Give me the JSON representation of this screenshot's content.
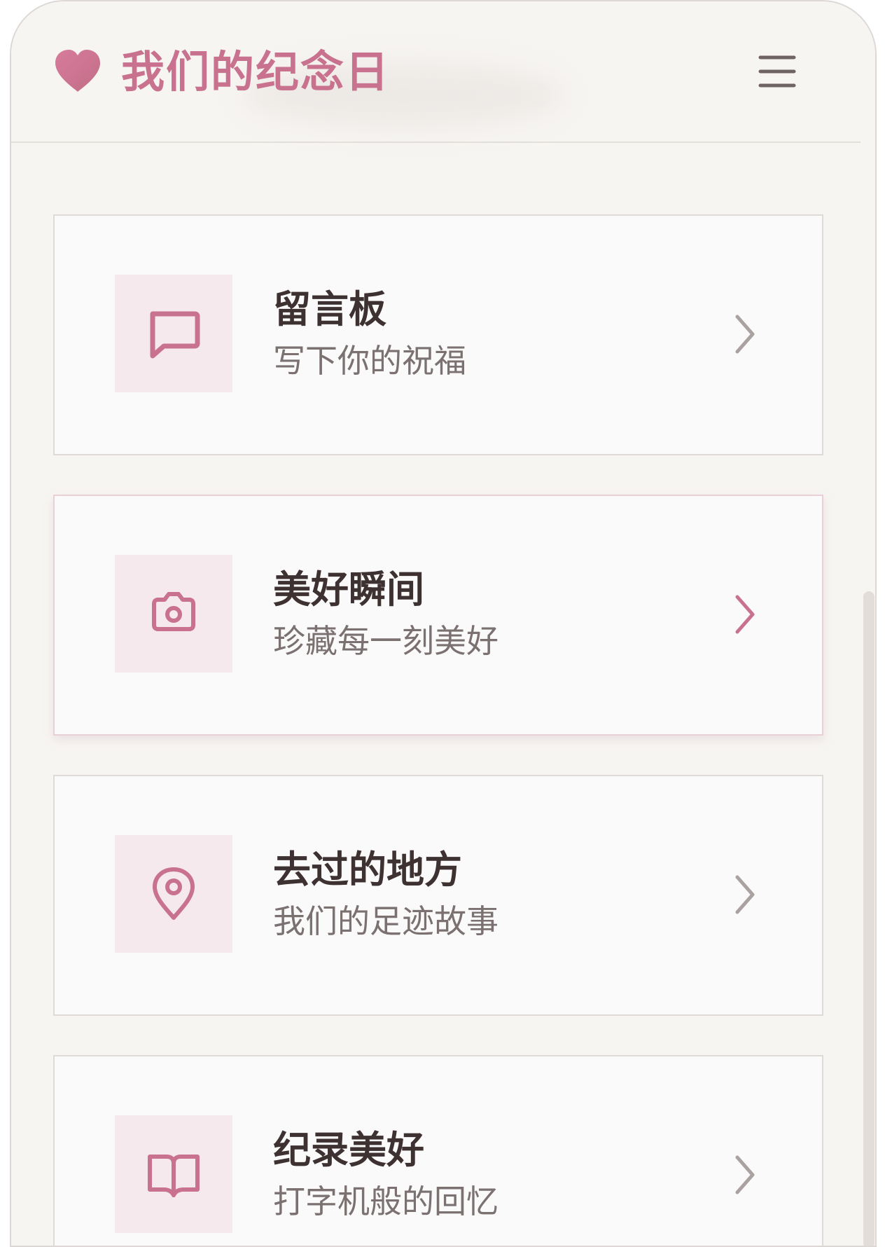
{
  "app": {
    "title": "我们的纪念日",
    "logo_icon": "heart-icon",
    "menu_icon": "hamburger-menu-icon",
    "accent_color": "#c8728f"
  },
  "menu": {
    "items": [
      {
        "title": "留言板",
        "subtitle": "写下你的祝福",
        "icon": "message-square-icon",
        "active": false
      },
      {
        "title": "美好瞬间",
        "subtitle": "珍藏每一刻美好",
        "icon": "camera-icon",
        "active": true
      },
      {
        "title": "去过的地方",
        "subtitle": "我们的足迹故事",
        "icon": "map-pin-icon",
        "active": false
      },
      {
        "title": "纪录美好",
        "subtitle": "打字机般的回忆",
        "icon": "book-open-icon",
        "active": false
      }
    ]
  }
}
